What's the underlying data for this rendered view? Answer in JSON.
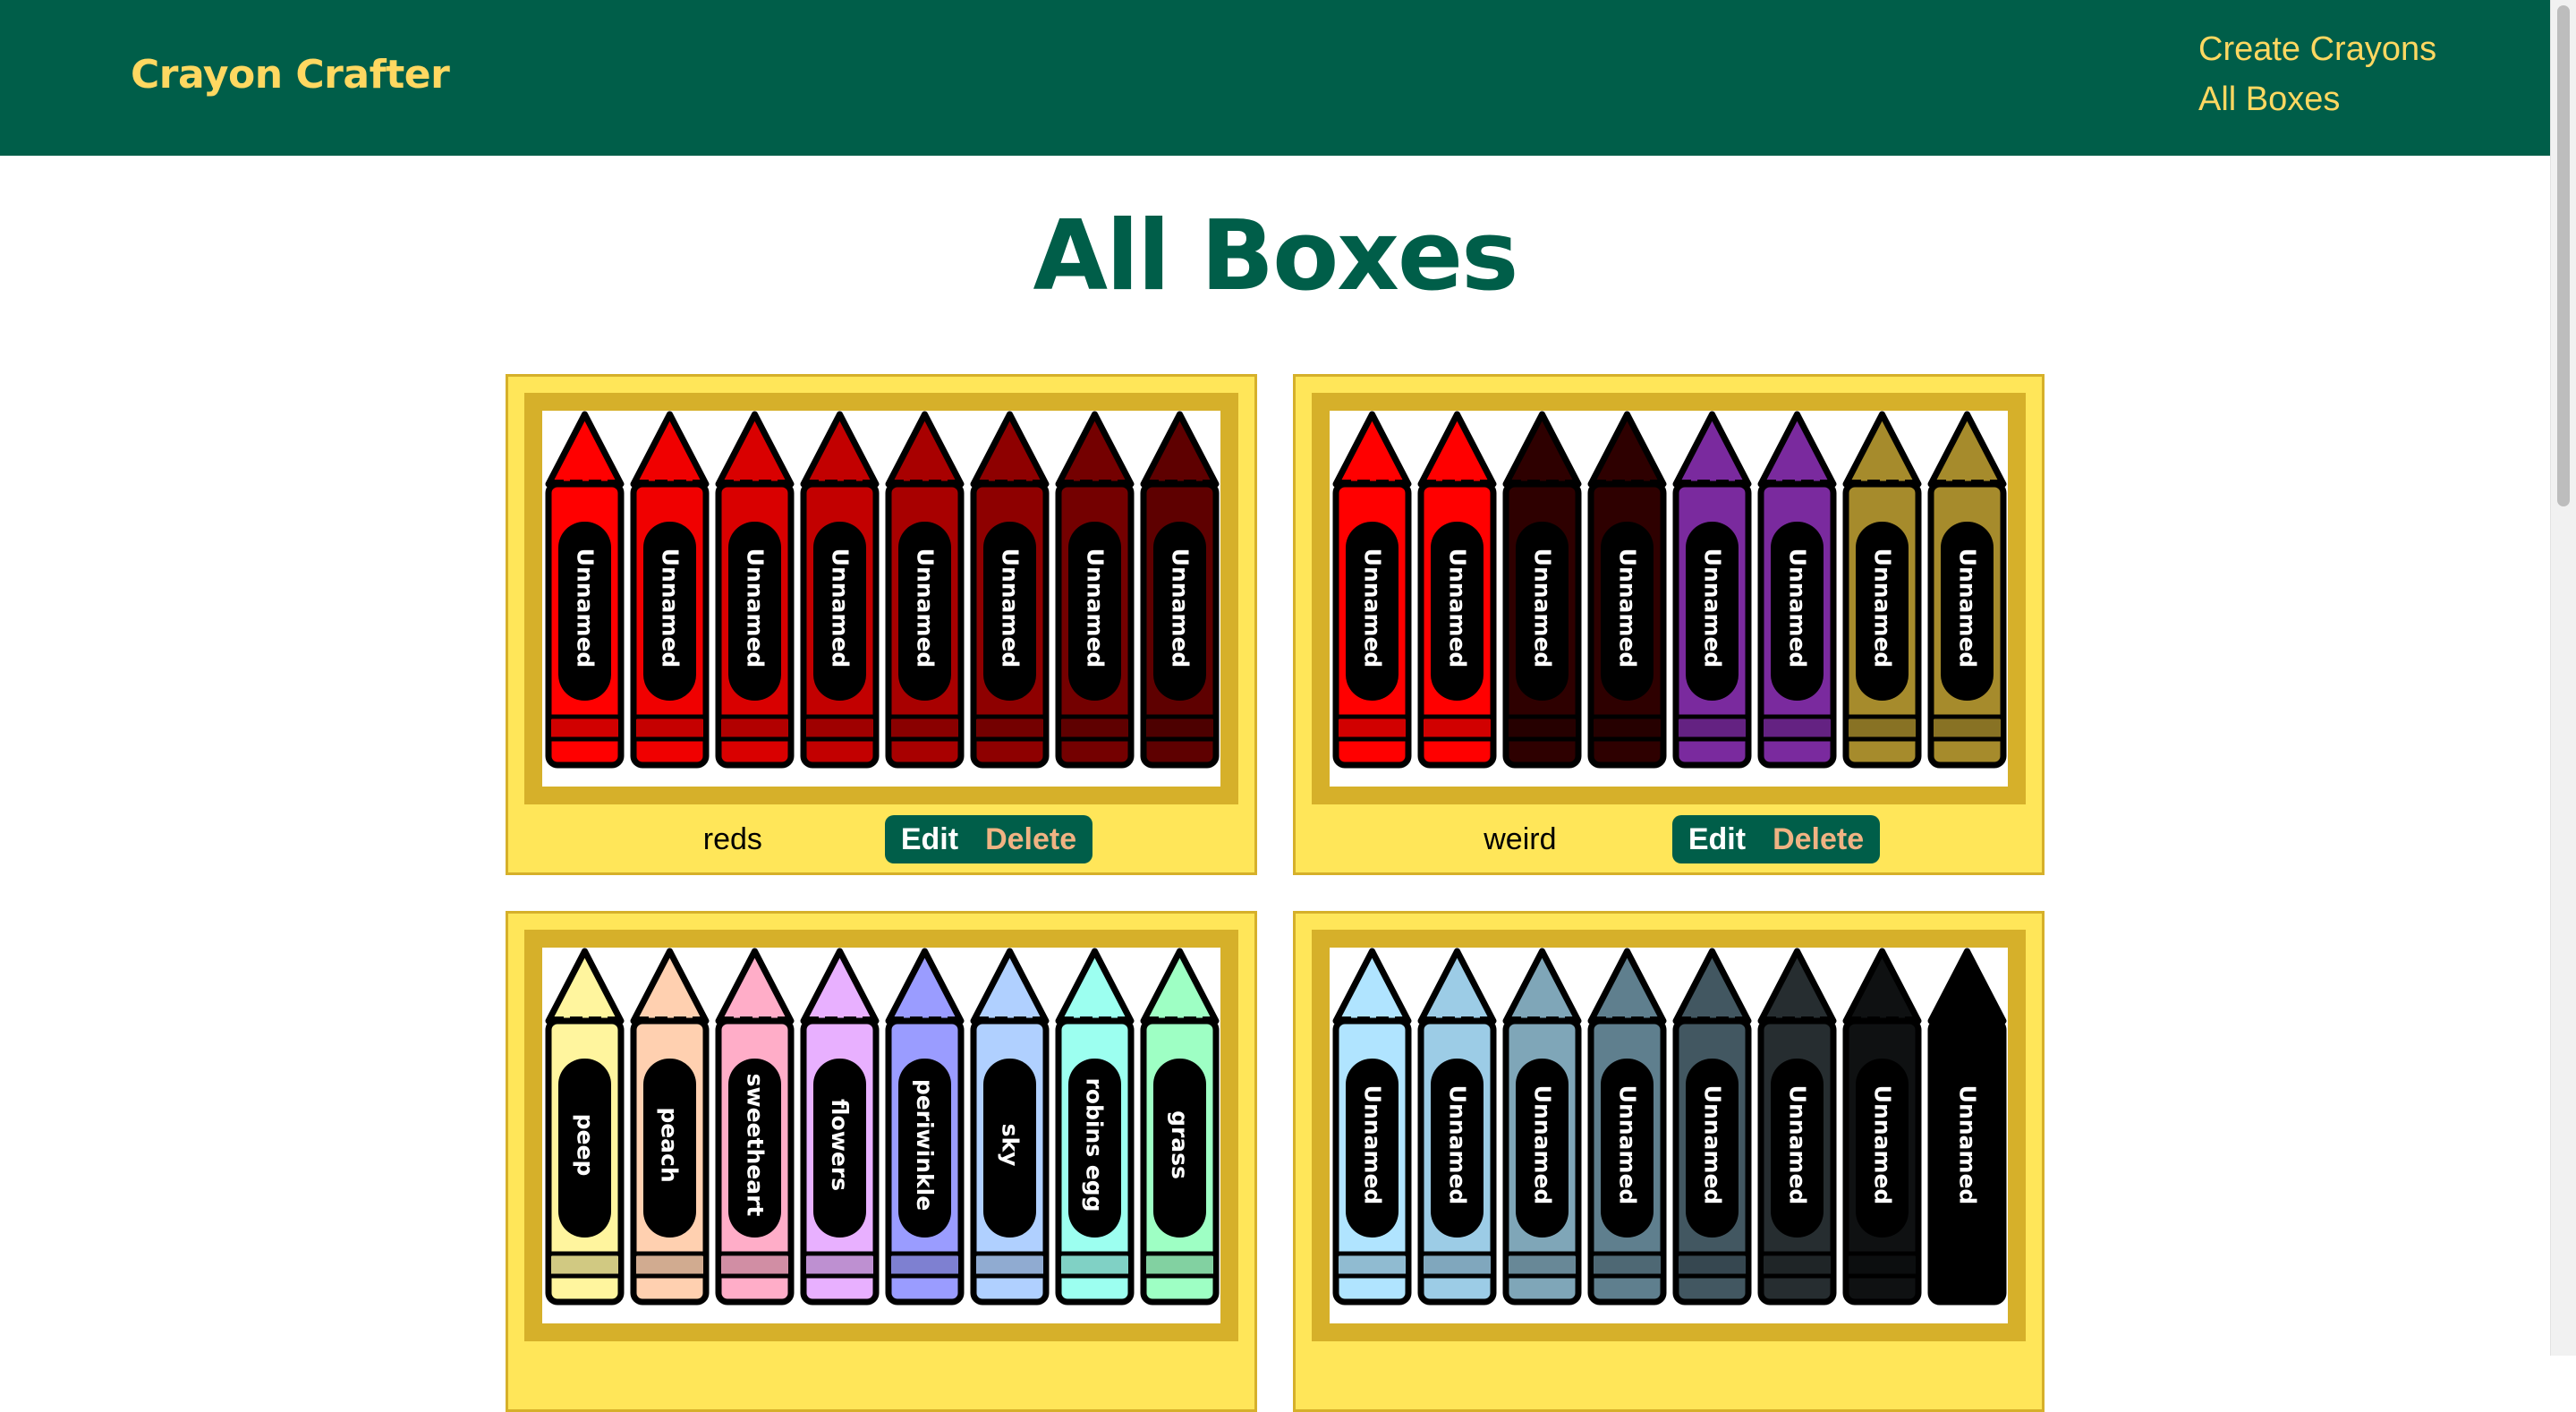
{
  "navbar": {
    "brand": "Crayon Crafter",
    "links": [
      "Create Crayons",
      "All Boxes"
    ]
  },
  "page": {
    "title": "All Boxes"
  },
  "boxes": [
    {
      "name": "reds",
      "edit_label": "Edit",
      "delete_label": "Delete",
      "crayons": [
        {
          "label": "Unnamed",
          "color": "#ff0000"
        },
        {
          "label": "Unnamed",
          "color": "#f00000"
        },
        {
          "label": "Unnamed",
          "color": "#d90000"
        },
        {
          "label": "Unnamed",
          "color": "#c20000"
        },
        {
          "label": "Unnamed",
          "color": "#a80000"
        },
        {
          "label": "Unnamed",
          "color": "#8e0000"
        },
        {
          "label": "Unnamed",
          "color": "#740000"
        },
        {
          "label": "Unnamed",
          "color": "#5e0000"
        }
      ]
    },
    {
      "name": "weird",
      "edit_label": "Edit",
      "delete_label": "Delete",
      "crayons": [
        {
          "label": "Unnamed",
          "color": "#ff0000"
        },
        {
          "label": "Unnamed",
          "color": "#ff0000"
        },
        {
          "label": "Unnamed",
          "color": "#2e0000"
        },
        {
          "label": "Unnamed",
          "color": "#2e0000"
        },
        {
          "label": "Unnamed",
          "color": "#7a2a9e"
        },
        {
          "label": "Unnamed",
          "color": "#7a2a9e"
        },
        {
          "label": "Unnamed",
          "color": "#a68b2c"
        },
        {
          "label": "Unnamed",
          "color": "#a68b2c"
        }
      ]
    },
    {
      "name": "",
      "edit_label": "",
      "delete_label": "",
      "crayons": [
        {
          "label": "peep",
          "color": "#fff59e"
        },
        {
          "label": "peach",
          "color": "#ffd0b0"
        },
        {
          "label": "sweetheart",
          "color": "#ffadc8"
        },
        {
          "label": "flowers",
          "color": "#e8b0ff"
        },
        {
          "label": "periwinkle",
          "color": "#9a9cff"
        },
        {
          "label": "sky",
          "color": "#b0d0ff"
        },
        {
          "label": "robins egg",
          "color": "#9cfff0"
        },
        {
          "label": "grass",
          "color": "#9effc4"
        }
      ]
    },
    {
      "name": "",
      "edit_label": "",
      "delete_label": "",
      "crayons": [
        {
          "label": "Unnamed",
          "color": "#b0e4ff"
        },
        {
          "label": "Unnamed",
          "color": "#9ccce6"
        },
        {
          "label": "Unnamed",
          "color": "#7fa6b8"
        },
        {
          "label": "Unnamed",
          "color": "#5f7f8e"
        },
        {
          "label": "Unnamed",
          "color": "#425761"
        },
        {
          "label": "Unnamed",
          "color": "#262d30"
        },
        {
          "label": "Unnamed",
          "color": "#0f1112"
        },
        {
          "label": "Unnamed",
          "color": "#000000"
        }
      ]
    }
  ]
}
